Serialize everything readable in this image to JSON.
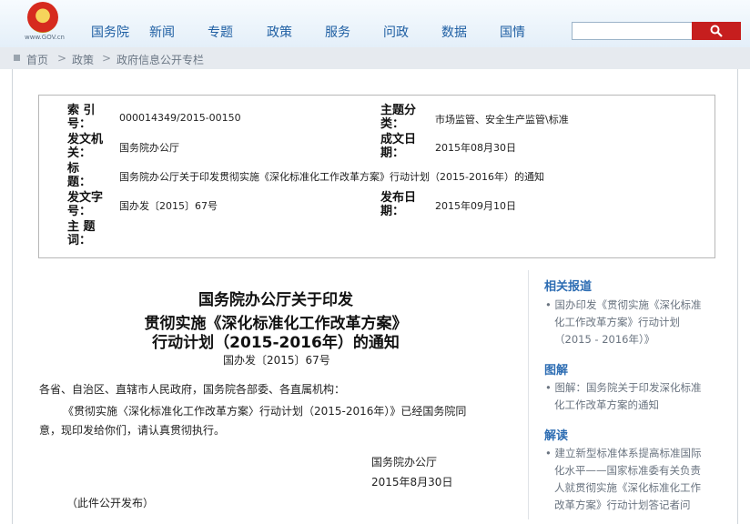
{
  "header": {
    "emblem_label": "national-emblem",
    "site_url": "www.GOV.cn",
    "nav": [
      "国务院",
      "新闻",
      "专题",
      "政策",
      "服务",
      "问政",
      "数据",
      "国情"
    ],
    "search": {
      "value": "",
      "placeholder": ""
    },
    "search_icon": "search-icon"
  },
  "breadcrumb": {
    "items": [
      "首页",
      "政策",
      "政府信息公开专栏"
    ],
    "separator": ">"
  },
  "meta": {
    "index_label_l1": "索  引",
    "index_label_l2": "号：",
    "index_value": "000014349/2015-00150",
    "subject_label_l1": "主题分",
    "subject_label_l2": "类：",
    "subject_value": "市场监管、安全生产监管\\标准",
    "issuer_label_l1": "发文机",
    "issuer_label_l2": "关：",
    "issuer_value": "国务院办公厅",
    "written_label_l1": "成文日",
    "written_label_l2": "期：",
    "written_value": "2015年08月30日",
    "title_label_l1": "标",
    "title_label_l2": "题：",
    "title_value": "国务院办公厅关于印发贯彻实施《深化标准化工作改革方案》行动计划（2015-2016年）的通知",
    "docno_label_l1": "发文字",
    "docno_label_l2": "号：",
    "docno_value": "国办发〔2015〕67号",
    "published_label_l1": "发布日",
    "published_label_l2": "期：",
    "published_value": "2015年09月10日",
    "keywords_label_l1": "主  题",
    "keywords_label_l2": "词："
  },
  "article": {
    "title_line1": "国务院办公厅关于印发",
    "title_line2": "贯彻实施《深化标准化工作改革方案》",
    "title_line3": "行动计划（2015-2016年）的通知",
    "doc_number": "国办发〔2015〕67号",
    "salutation": "各省、自治区、直辖市人民政府，国务院各部委、各直属机构：",
    "para1_line1": "《贯彻实施〈深化标准化工作改革方案〉行动计划（2015-2016年）》已经国务院同",
    "para1_line2": "意，现印发给你们，请认真贯彻执行。",
    "signature": "国务院办公厅",
    "date": "2015年8月30日",
    "note": "（此件公开发布）"
  },
  "sidebar": {
    "related_heading": "相关报道",
    "related_item_line1": "国办印发《贯彻实施《深化标准",
    "related_item_line2": "化工作改革方案》行动计划",
    "related_item_line3": "（2015 - 2016年）》",
    "illustration_heading": "图解",
    "illustration_item_line1": "图解：国务院关于印发深化标准",
    "illustration_item_line2": "化工作改革方案的通知",
    "interpretation_heading": "解读",
    "interpretation_item_line1": "建立新型标准体系提高标准国际",
    "interpretation_item_line2": "化水平——国家标准委有关负责",
    "interpretation_item_line3": "人就贯彻实施《深化标准化工作",
    "interpretation_item_line4": "改革方案》行动计划答记者问"
  },
  "colors": {
    "nav_text": "#1f5fa3",
    "search_button": "#c61e1e",
    "sidebar_heading": "#2d6db3",
    "breadcrumb_bg": "#e6eaef"
  }
}
